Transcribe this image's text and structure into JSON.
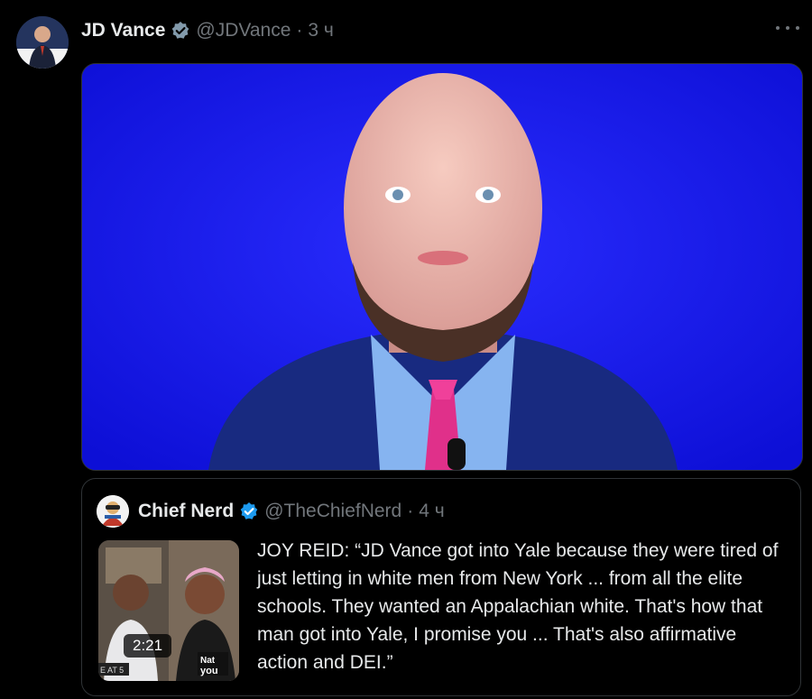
{
  "post": {
    "author_name": "JD Vance",
    "handle": "@JDVance",
    "separator": "·",
    "time": "3 ч"
  },
  "quote": {
    "author_name": "Chief Nerd",
    "handle": "@TheChiefNerd",
    "separator": "·",
    "time": "4 ч",
    "video_duration": "2:21",
    "text": "JOY REID: “JD Vance got into Yale because they were tired of just letting in white men from New York ... from all the elite schools. They wanted an Appalachian white. That's how that man got into Yale, I promise you ... That's also affirmative action and DEI.”"
  },
  "icons": {
    "verified": "verified-badge-icon",
    "more": "more-options-icon"
  },
  "colors": {
    "background": "#000000",
    "primary_text": "#e7e9ea",
    "secondary_text": "#71767b",
    "verified_blue": "#1d9bf0",
    "verified_gray": "#829aab",
    "border": "#2f3336",
    "media_background": "#1414f0"
  }
}
